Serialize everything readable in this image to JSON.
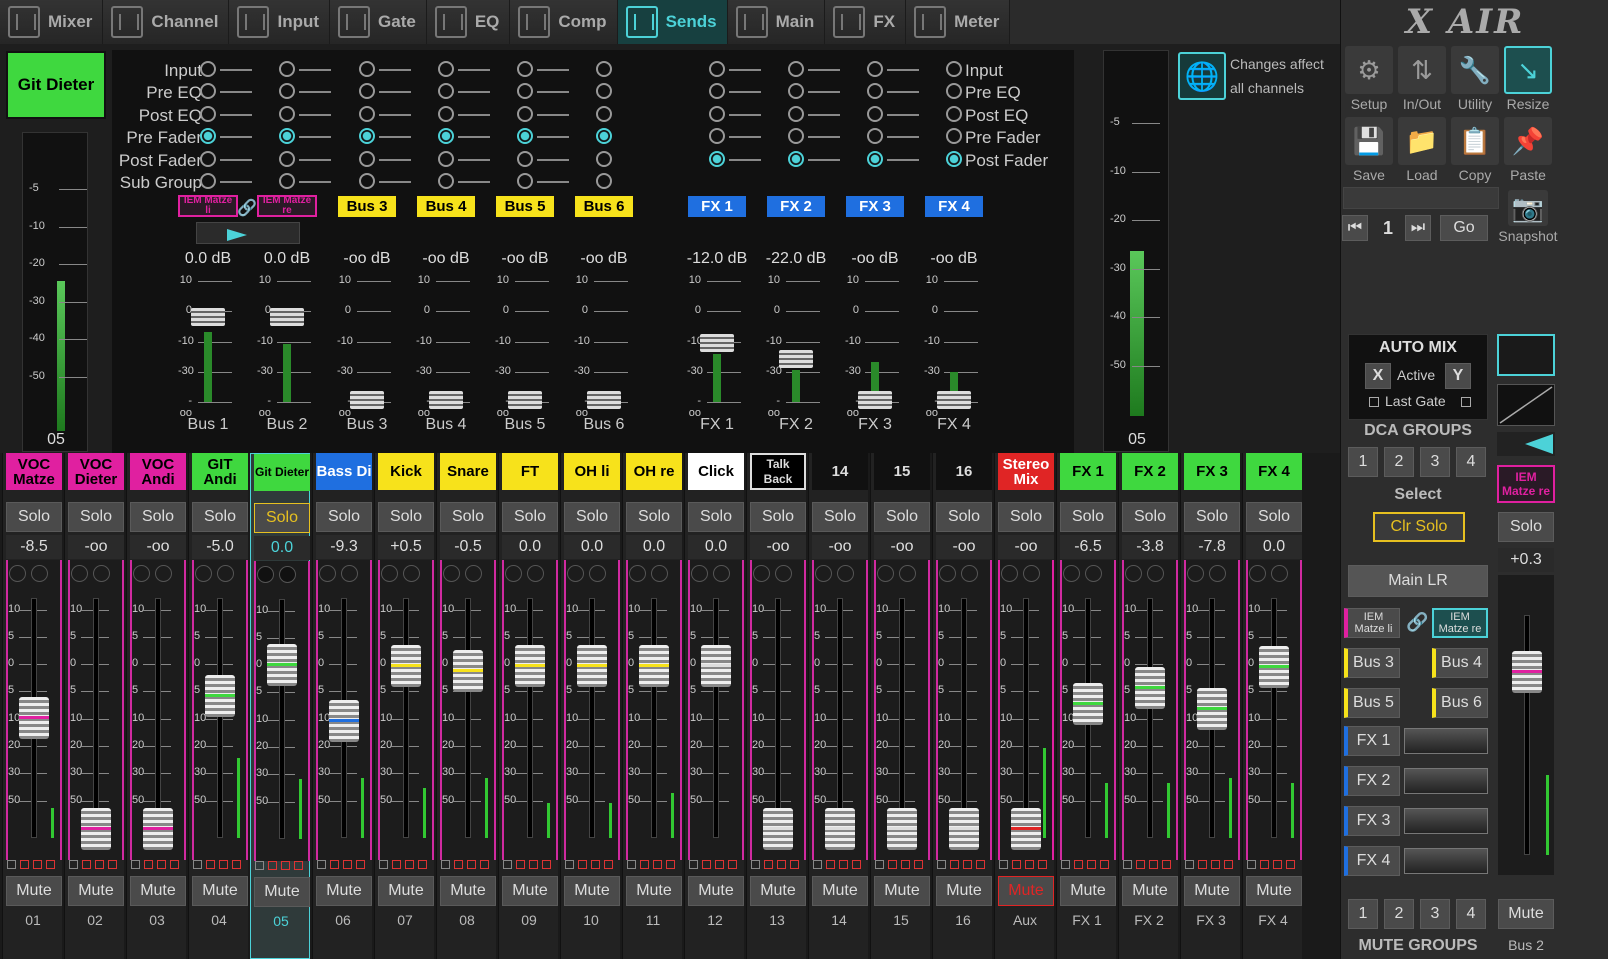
{
  "tabs": [
    {
      "label": "Mixer",
      "icon": "mixer-icon"
    },
    {
      "label": "Channel",
      "icon": "channel-icon"
    },
    {
      "label": "Input",
      "icon": "input-icon"
    },
    {
      "label": "Gate",
      "icon": "gate-icon"
    },
    {
      "label": "EQ",
      "icon": "eq-icon"
    },
    {
      "label": "Comp",
      "icon": "comp-icon"
    },
    {
      "label": "Sends",
      "icon": "sends-icon",
      "active": true
    },
    {
      "label": "Main",
      "icon": "main-icon"
    },
    {
      "label": "FX",
      "icon": "fx-icon"
    },
    {
      "label": "Meter",
      "icon": "meter-icon"
    }
  ],
  "logo": "X AIR",
  "channel_name": "Git Dieter",
  "channel_meter_label": "05",
  "channel_meter_scale": [
    "-5",
    "-10",
    "-20",
    "-30",
    "-40",
    "-50"
  ],
  "main_meter_label": "05",
  "main_meter_scale": [
    "-5",
    "-10",
    "-20",
    "-30",
    "-40",
    "-50"
  ],
  "changes_note": "Changes affect all channels",
  "tap_points_left": [
    "Input",
    "Pre EQ",
    "Post EQ",
    "Pre Fader",
    "Post Fader",
    "Sub Group"
  ],
  "tap_points_right": [
    "Input",
    "Pre EQ",
    "Post EQ",
    "Pre Fader",
    "Post Fader"
  ],
  "buses": [
    {
      "tag": "IEM Matze li",
      "db": "0.0 dB",
      "label": "Bus 1",
      "color": "#e020a0"
    },
    {
      "tag": "IEM Matze re",
      "db": "0.0 dB",
      "label": "Bus 2",
      "color": "#e020a0"
    },
    {
      "tag": "Bus 3",
      "db": "-oo dB",
      "label": "Bus 3",
      "color": "#f7e21b"
    },
    {
      "tag": "Bus 4",
      "db": "-oo dB",
      "label": "Bus 4",
      "color": "#f7e21b"
    },
    {
      "tag": "Bus 5",
      "db": "-oo dB",
      "label": "Bus 5",
      "color": "#f7e21b"
    },
    {
      "tag": "Bus 6",
      "db": "-oo dB",
      "label": "Bus 6",
      "color": "#f7e21b"
    },
    {
      "tag": "FX 1",
      "db": "-12.0 dB",
      "label": "FX 1",
      "color": "#1f6fe0"
    },
    {
      "tag": "FX 2",
      "db": "-22.0 dB",
      "label": "FX 2",
      "color": "#1f6fe0"
    },
    {
      "tag": "FX 3",
      "db": "-oo dB",
      "label": "FX 3",
      "color": "#1f6fe0"
    },
    {
      "tag": "FX 4",
      "db": "-oo dB",
      "label": "FX 4",
      "color": "#1f6fe0"
    }
  ],
  "mini_scale": [
    "10",
    "0",
    "-10",
    "-30",
    "-oo"
  ],
  "channels": [
    {
      "name": "VOC Matze",
      "color": "#e020a0",
      "value": "-8.5",
      "num": "01"
    },
    {
      "name": "VOC Dieter",
      "color": "#e020a0",
      "value": "-oo",
      "num": "02"
    },
    {
      "name": "VOC Andi",
      "color": "#e020a0",
      "value": "-oo",
      "num": "03"
    },
    {
      "name": "GIT Andi",
      "color": "#3fd83f",
      "value": "-5.0",
      "num": "04"
    },
    {
      "name": "Git Dieter",
      "color": "#3fd83f",
      "value": "0.0",
      "num": "05",
      "selected": true
    },
    {
      "name": "Bass Di",
      "color": "#1f6fe0",
      "value": "-9.3",
      "num": "06"
    },
    {
      "name": "Kick",
      "color": "#f7e21b",
      "value": "+0.5",
      "num": "07"
    },
    {
      "name": "Snare",
      "color": "#f7e21b",
      "value": "-0.5",
      "num": "08"
    },
    {
      "name": "FT",
      "color": "#f7e21b",
      "value": "0.0",
      "num": "09"
    },
    {
      "name": "OH li",
      "color": "#f7e21b",
      "value": "0.0",
      "num": "10"
    },
    {
      "name": "OH re",
      "color": "#f7e21b",
      "value": "0.0",
      "num": "11"
    },
    {
      "name": "Click",
      "color": "#ffffff",
      "value": "0.0",
      "num": "12"
    },
    {
      "name": "Talk Back",
      "color": "#000000",
      "value": "-oo",
      "num": "13"
    },
    {
      "name": "14",
      "color": "#111111",
      "value": "-oo",
      "num": "14"
    },
    {
      "name": "15",
      "color": "#111111",
      "value": "-oo",
      "num": "15"
    },
    {
      "name": "16",
      "color": "#111111",
      "value": "-oo",
      "num": "16"
    },
    {
      "name": "Stereo Mix",
      "color": "#e02525",
      "value": "-oo",
      "num": "Aux"
    },
    {
      "name": "FX 1",
      "color": "#3fd83f",
      "value": "-6.5",
      "num": "FX 1"
    },
    {
      "name": "FX 2",
      "color": "#3fd83f",
      "value": "-3.8",
      "num": "FX 2"
    },
    {
      "name": "FX 3",
      "color": "#3fd83f",
      "value": "-7.8",
      "num": "FX 3"
    },
    {
      "name": "FX 4",
      "color": "#3fd83f",
      "value": "0.0",
      "num": "FX 4"
    }
  ],
  "solo_label": "Solo",
  "mute_label": "Mute",
  "fader_scale": [
    "10",
    "5",
    "0",
    "5",
    "10",
    "20",
    "30",
    "50"
  ],
  "right": {
    "setup": "Setup",
    "inout": "In/Out",
    "utility": "Utility",
    "resize": "Resize",
    "save": "Save",
    "load": "Load",
    "copy": "Copy",
    "paste": "Paste",
    "snapshot_num": "1",
    "go": "Go",
    "snapshot": "Snapshot",
    "automix_title": "AUTO MIX",
    "automix_x": "X",
    "automix_active": "Active",
    "automix_y": "Y",
    "last_gate": "Last Gate",
    "dca_title": "DCA GROUPS",
    "dca": [
      "1",
      "2",
      "3",
      "4"
    ],
    "select": "Select",
    "clr_solo": "Clr Solo",
    "main_lr": "Main LR",
    "bus_buttons": [
      "IEM Matze li",
      "IEM Matze re",
      "Bus 3",
      "Bus 4",
      "Bus 5",
      "Bus 6",
      "FX 1",
      "FX 2",
      "FX 3",
      "FX 4"
    ],
    "mute_groups": [
      "1",
      "2",
      "3",
      "4"
    ],
    "mute_groups_title": "MUTE GROUPS",
    "bus2_name": "IEM Matze re",
    "bus2_solo": "Solo",
    "bus2_value": "+0.3",
    "bus2_mute": "Mute",
    "bus2_num": "Bus 2"
  }
}
